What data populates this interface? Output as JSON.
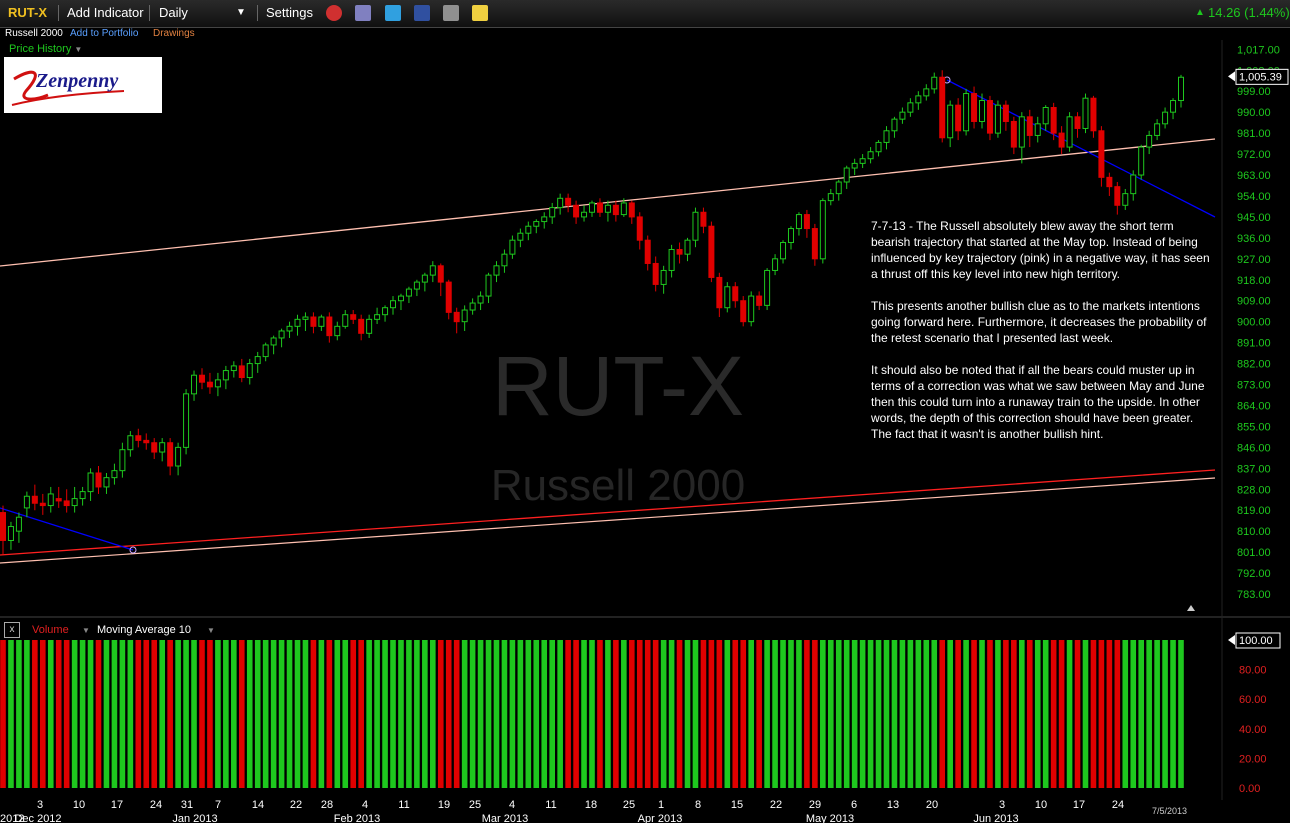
{
  "toolbar": {
    "symbol": "RUT-X",
    "add_indicator": "Add Indicator",
    "interval": "Daily",
    "settings": "Settings",
    "change": "14.26 (1.44%)"
  },
  "subbar": {
    "name": "Russell 2000",
    "add_to_portfolio": "Add to Portfolio",
    "drawings": "Drawings"
  },
  "price_history_label": "Price History",
  "logo_text": "Zenpenny",
  "watermark": {
    "symbol": "RUT-X",
    "name": "Russell 2000"
  },
  "annotation": "7-7-13 - The Russell absolutely blew away the short term bearish trajectory that started at the May top. Instead of being influenced by key trajectory (pink) in a negative way, it has seen a thrust off this key level into new high territory.\n\nThis presents another bullish clue as to the markets intentions going forward here. Furthermore, it decreases the probability of the retest scenario that I presented last week.\n\nIt should also be noted that if all the bears could muster up in terms of a correction was what we saw between May and June then this could turn into a runaway train to the upside. In other words, the depth of this correction should have been greater. The fact that it wasn't is another bullish hint.",
  "volume_panel": {
    "label": "Volume",
    "ma_label": "Moving Average 10",
    "current": "100.00"
  },
  "date_stamp": "7/5/2013",
  "colors": {
    "up": "#1ec81e",
    "down": "#e00000",
    "trend_down": "#0000ff",
    "trend_key": "#ffc0b0",
    "trend_red": "#ff2020"
  },
  "chart_data": {
    "type": "candlestick",
    "price_axis": {
      "ticks": [
        "1,017.00",
        "1,008.00",
        "999.00",
        "990.00",
        "981.00",
        "972.00",
        "963.00",
        "954.00",
        "945.00",
        "936.00",
        "927.00",
        "918.00",
        "909.00",
        "900.00",
        "891.00",
        "882.00",
        "873.00",
        "864.00",
        "855.00",
        "846.00",
        "837.00",
        "828.00",
        "819.00",
        "810.00",
        "801.00",
        "792.00",
        "783.00"
      ],
      "current": "1,005.39",
      "range": [
        777,
        1021
      ]
    },
    "volume_axis": {
      "ticks": [
        "100.00",
        "80.00",
        "60.00",
        "40.00",
        "20.00",
        "0.00"
      ],
      "range": [
        0,
        100
      ]
    },
    "x_day_labels": [
      "3",
      "10",
      "17",
      "24",
      "31",
      "7",
      "14",
      "22",
      "28",
      "4",
      "11",
      "19",
      "25",
      "4",
      "11",
      "18",
      "25",
      "1",
      "8",
      "15",
      "22",
      "29",
      "6",
      "13",
      "20",
      "3",
      "10",
      "17",
      "24"
    ],
    "x_month_labels": [
      "Dec 2012",
      "Jan 2013",
      "Feb 2013",
      "Mar 2013",
      "Apr 2013",
      "May 2013",
      "Jun 2013"
    ],
    "x_left_cut_label": "2012",
    "candles": [
      [
        1,
        0,
        818,
        806,
        821,
        800
      ],
      [
        1,
        0,
        806,
        812,
        814,
        802
      ],
      [
        1,
        1,
        810,
        816,
        818,
        805
      ],
      [
        1,
        2,
        820,
        825,
        827,
        816
      ],
      [
        1,
        2,
        825,
        822,
        830,
        819
      ],
      [
        1,
        3,
        822,
        821,
        826,
        817
      ],
      [
        1,
        3,
        821,
        826,
        829,
        818
      ],
      [
        1,
        4,
        824,
        823,
        829,
        820
      ],
      [
        1,
        4,
        823,
        821,
        828,
        818
      ],
      [
        1,
        5,
        821,
        824,
        829,
        818
      ],
      [
        1,
        5,
        824,
        827,
        829,
        821
      ],
      [
        2,
        0,
        827,
        835,
        837,
        823
      ],
      [
        2,
        0,
        835,
        829,
        838,
        826
      ],
      [
        2,
        1,
        829,
        833,
        835,
        826
      ],
      [
        2,
        1,
        833,
        836,
        839,
        830
      ],
      [
        2,
        1,
        836,
        845,
        848,
        833
      ],
      [
        2,
        2,
        845,
        851,
        853,
        842
      ],
      [
        2,
        2,
        851,
        849,
        854,
        846
      ],
      [
        2,
        3,
        849,
        848,
        852,
        845
      ],
      [
        2,
        3,
        848,
        844,
        850,
        841
      ],
      [
        2,
        4,
        844,
        848,
        850,
        840
      ],
      [
        2,
        4,
        848,
        838,
        850,
        834
      ],
      [
        2,
        5,
        838,
        846,
        848,
        834
      ],
      [
        2,
        5,
        846,
        869,
        871,
        843
      ],
      [
        2,
        6,
        869,
        877,
        879,
        866
      ],
      [
        2,
        6,
        877,
        874,
        880,
        871
      ],
      [
        2,
        6,
        874,
        872,
        878,
        869
      ],
      [
        2,
        7,
        872,
        875,
        878,
        868
      ],
      [
        2,
        7,
        875,
        879,
        881,
        871
      ],
      [
        2,
        7,
        879,
        881,
        883,
        876
      ],
      [
        2,
        8,
        881,
        876,
        884,
        874
      ],
      [
        2,
        8,
        876,
        882,
        884,
        873
      ],
      [
        2,
        8,
        882,
        885,
        887,
        878
      ],
      [
        2,
        9,
        885,
        890,
        891,
        883
      ],
      [
        2,
        9,
        890,
        893,
        894,
        886
      ],
      [
        2,
        9,
        893,
        896,
        897,
        889
      ],
      [
        2,
        10,
        896,
        898,
        900,
        893
      ],
      [
        2,
        10,
        898,
        901,
        903,
        894
      ],
      [
        2,
        10,
        901,
        902,
        904,
        896
      ],
      [
        2,
        11,
        902,
        898,
        904,
        895
      ],
      [
        2,
        11,
        898,
        902,
        903,
        896
      ],
      [
        2,
        12,
        902,
        894,
        904,
        891
      ],
      [
        2,
        12,
        894,
        898,
        900,
        892
      ],
      [
        2,
        13,
        898,
        903,
        905,
        897
      ],
      [
        2,
        13,
        903,
        901,
        905,
        899
      ],
      [
        2,
        13,
        901,
        895,
        903,
        892
      ],
      [
        2,
        14,
        895,
        901,
        903,
        893
      ],
      [
        2,
        14,
        901,
        903,
        906,
        899
      ],
      [
        2,
        14,
        903,
        906,
        907,
        900
      ],
      [
        2,
        15,
        906,
        909,
        911,
        903
      ],
      [
        2,
        15,
        909,
        911,
        912,
        905
      ],
      [
        2,
        15,
        911,
        914,
        915,
        908
      ],
      [
        2,
        16,
        914,
        917,
        918,
        911
      ],
      [
        2,
        16,
        917,
        920,
        921,
        913
      ],
      [
        2,
        16,
        920,
        924,
        926,
        917
      ],
      [
        2,
        17,
        924,
        917,
        925,
        911
      ],
      [
        2,
        17,
        917,
        904,
        918,
        901
      ],
      [
        2,
        18,
        904,
        900,
        906,
        895
      ],
      [
        2,
        18,
        900,
        905,
        907,
        896
      ],
      [
        2,
        18,
        905,
        908,
        910,
        903
      ],
      [
        2,
        19,
        908,
        911,
        913,
        905
      ],
      [
        2,
        19,
        911,
        920,
        921,
        908
      ],
      [
        2,
        20,
        920,
        924,
        926,
        917
      ],
      [
        2,
        20,
        924,
        929,
        931,
        921
      ],
      [
        2,
        20,
        929,
        935,
        937,
        927
      ],
      [
        2,
        21,
        935,
        938,
        940,
        932
      ],
      [
        2,
        21,
        938,
        941,
        943,
        935
      ],
      [
        2,
        21,
        941,
        943,
        944,
        938
      ],
      [
        2,
        22,
        943,
        945,
        947,
        940
      ],
      [
        2,
        22,
        945,
        949,
        951,
        942
      ],
      [
        2,
        22,
        949,
        953,
        955,
        946
      ],
      [
        2,
        23,
        953,
        950,
        955,
        947
      ],
      [
        2,
        23,
        950,
        945,
        952,
        942
      ],
      [
        2,
        23,
        945,
        947,
        950,
        943
      ],
      [
        2,
        24,
        947,
        951,
        952,
        945
      ],
      [
        2,
        24,
        951,
        947,
        953,
        945
      ],
      [
        2,
        25,
        947,
        950,
        952,
        943
      ],
      [
        2,
        25,
        950,
        946,
        952,
        943
      ],
      [
        2,
        25,
        946,
        951,
        953,
        945
      ],
      [
        2,
        26,
        951,
        945,
        952,
        942
      ],
      [
        2,
        26,
        945,
        935,
        947,
        931
      ],
      [
        2,
        26,
        935,
        925,
        937,
        922
      ],
      [
        2,
        26,
        925,
        916,
        928,
        913
      ],
      [
        2,
        27,
        916,
        922,
        924,
        912
      ],
      [
        2,
        27,
        922,
        931,
        933,
        919
      ],
      [
        2,
        27,
        931,
        929,
        934,
        925
      ],
      [
        2,
        28,
        929,
        935,
        936,
        926
      ],
      [
        2,
        28,
        935,
        947,
        949,
        932
      ],
      [
        2,
        28,
        947,
        941,
        949,
        938
      ],
      [
        2,
        29,
        941,
        919,
        943,
        917
      ],
      [
        2,
        29,
        919,
        906,
        921,
        902
      ],
      [
        2,
        30,
        906,
        915,
        917,
        904
      ],
      [
        2,
        30,
        915,
        909,
        917,
        906
      ],
      [
        2,
        30,
        909,
        900,
        911,
        898
      ],
      [
        2,
        31,
        900,
        911,
        913,
        898
      ],
      [
        2,
        31,
        911,
        907,
        913,
        905
      ],
      [
        2,
        31,
        907,
        922,
        923,
        905
      ],
      [
        2,
        31,
        922,
        927,
        929,
        920
      ],
      [
        2,
        32,
        927,
        934,
        935,
        925
      ],
      [
        2,
        32,
        934,
        940,
        941,
        931
      ],
      [
        2,
        32,
        940,
        946,
        947,
        937
      ],
      [
        2,
        33,
        946,
        940,
        948,
        936
      ],
      [
        2,
        33,
        940,
        927,
        942,
        924
      ],
      [
        2,
        33,
        927,
        952,
        953,
        925
      ],
      [
        2,
        34,
        952,
        955,
        957,
        950
      ],
      [
        2,
        34,
        955,
        960,
        961,
        952
      ],
      [
        2,
        34,
        960,
        966,
        967,
        957
      ],
      [
        2,
        35,
        966,
        968,
        970,
        963
      ],
      [
        2,
        35,
        968,
        970,
        972,
        966
      ],
      [
        2,
        35,
        970,
        973,
        975,
        968
      ],
      [
        2,
        36,
        973,
        977,
        978,
        971
      ],
      [
        2,
        36,
        977,
        982,
        984,
        974
      ],
      [
        2,
        36,
        982,
        987,
        988,
        979
      ],
      [
        2,
        36,
        987,
        990,
        992,
        985
      ],
      [
        2,
        37,
        990,
        994,
        996,
        988
      ],
      [
        2,
        37,
        994,
        997,
        999,
        991
      ],
      [
        2,
        37,
        997,
        1000,
        1002,
        995
      ],
      [
        2,
        38,
        1000,
        1005,
        1007,
        998
      ],
      [
        2,
        38,
        1005,
        979,
        1008,
        977
      ],
      [
        2,
        39,
        979,
        993,
        995,
        975
      ],
      [
        2,
        39,
        993,
        982,
        996,
        978
      ],
      [
        2,
        39,
        982,
        998,
        1000,
        980
      ],
      [
        2,
        40,
        998,
        986,
        1001,
        983
      ],
      [
        2,
        40,
        986,
        995,
        998,
        983
      ],
      [
        2,
        40,
        995,
        981,
        997,
        978
      ],
      [
        2,
        41,
        981,
        993,
        995,
        979
      ],
      [
        2,
        41,
        993,
        986,
        995,
        982
      ],
      [
        2,
        42,
        986,
        975,
        988,
        972
      ],
      [
        2,
        42,
        975,
        988,
        990,
        968
      ],
      [
        2,
        43,
        988,
        980,
        991,
        975
      ],
      [
        2,
        43,
        980,
        985,
        988,
        977
      ],
      [
        2,
        43,
        985,
        992,
        993,
        982
      ],
      [
        2,
        44,
        992,
        981,
        994,
        978
      ],
      [
        2,
        44,
        981,
        975,
        984,
        972
      ],
      [
        2,
        44,
        975,
        988,
        990,
        973
      ],
      [
        2,
        44,
        988,
        983,
        990,
        979
      ],
      [
        2,
        45,
        983,
        996,
        998,
        981
      ],
      [
        2,
        45,
        996,
        982,
        997,
        979
      ],
      [
        2,
        46,
        982,
        962,
        984,
        958
      ],
      [
        2,
        46,
        962,
        958,
        964,
        954
      ],
      [
        2,
        47,
        958,
        950,
        960,
        946
      ],
      [
        2,
        47,
        950,
        955,
        957,
        948
      ],
      [
        2,
        47,
        955,
        963,
        965,
        952
      ],
      [
        2,
        48,
        963,
        975,
        976,
        961
      ],
      [
        2,
        48,
        975,
        980,
        982,
        972
      ],
      [
        2,
        48,
        980,
        985,
        987,
        978
      ],
      [
        2,
        48,
        985,
        990,
        992,
        983
      ],
      [
        2,
        49,
        990,
        995,
        996,
        987
      ],
      [
        2,
        49,
        995,
        1005,
        1006,
        992
      ]
    ]
  }
}
